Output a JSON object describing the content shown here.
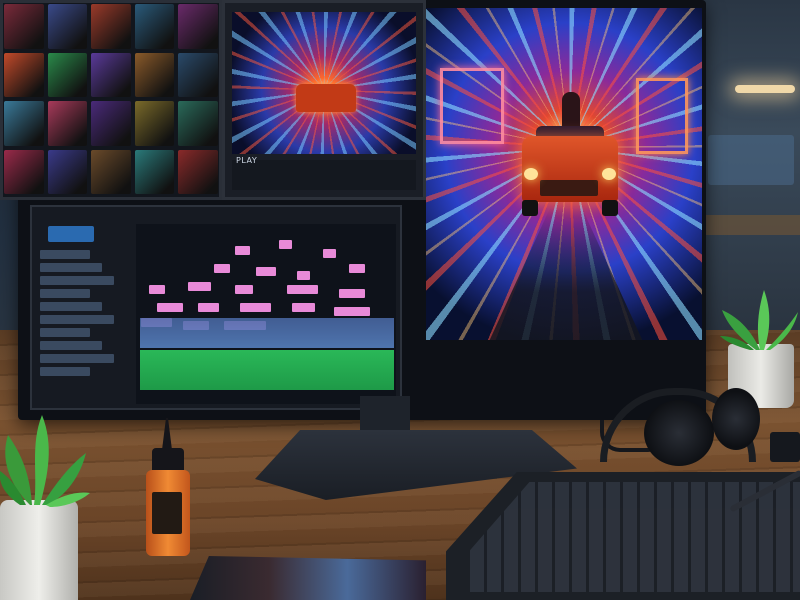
{
  "scene": {
    "description_colors": {
      "screen_glow_warm": "#ff6a2a",
      "screen_glow_cool": "#2a40c8",
      "timeline_pink": "#e88ad8",
      "timeline_blue": "#7aa8e0",
      "timeline_green": "#38e070",
      "desk_wood": "#7a5230"
    }
  },
  "back_monitor_left": {
    "thumbnail_colors": [
      "#7a2a3a",
      "#3a4a8a",
      "#9a3a2a",
      "#2a5a7a",
      "#6a2a6a",
      "#c24a2a",
      "#2a8a4a",
      "#5a3a9a",
      "#8a5a2a",
      "#2a4a6a",
      "#3a7a9a",
      "#a83a5a",
      "#4a2a7a",
      "#7a6a2a",
      "#2a6a5a",
      "#9a2a4a",
      "#3a3a8a",
      "#6a4a2a",
      "#2a7a7a",
      "#8a2a2a"
    ]
  },
  "back_monitor_mid": {
    "label": "PLAY"
  },
  "editor": {
    "toolbar_label": "",
    "clips_pink": [
      [
        0.38,
        0.08,
        0.06
      ],
      [
        0.55,
        0.05,
        0.05
      ],
      [
        0.72,
        0.1,
        0.05
      ],
      [
        0.3,
        0.18,
        0.06
      ],
      [
        0.46,
        0.2,
        0.08
      ],
      [
        0.62,
        0.22,
        0.05
      ],
      [
        0.82,
        0.18,
        0.06
      ],
      [
        0.05,
        0.3,
        0.06
      ],
      [
        0.2,
        0.28,
        0.09
      ],
      [
        0.38,
        0.3,
        0.07
      ],
      [
        0.58,
        0.3,
        0.12
      ],
      [
        0.78,
        0.32,
        0.1
      ],
      [
        0.08,
        0.4,
        0.1
      ],
      [
        0.24,
        0.4,
        0.08
      ],
      [
        0.4,
        0.4,
        0.12
      ],
      [
        0.6,
        0.4,
        0.09
      ],
      [
        0.76,
        0.42,
        0.14
      ],
      [
        0.02,
        0.48,
        0.12
      ],
      [
        0.18,
        0.5,
        0.1
      ],
      [
        0.34,
        0.5,
        0.16
      ]
    ],
    "tracks": 10
  }
}
